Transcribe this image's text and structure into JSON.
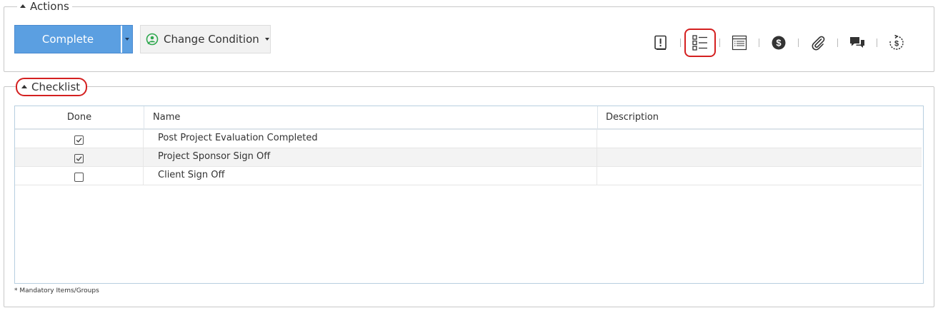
{
  "actions": {
    "legend": "Actions",
    "complete_label": "Complete",
    "change_condition_label": "Change Condition",
    "toolbar_icons": [
      "issues-icon",
      "checklist-icon",
      "details-icon",
      "cost-icon",
      "attachment-icon",
      "comments-icon",
      "budget-icon"
    ],
    "highlighted_icon": "checklist-icon"
  },
  "checklist": {
    "legend": "Checklist",
    "columns": [
      "Done",
      "Name",
      "Description"
    ],
    "rows": [
      {
        "done": true,
        "name": "Post Project Evaluation Completed",
        "description": ""
      },
      {
        "done": true,
        "name": "Project Sponsor Sign Off",
        "description": ""
      },
      {
        "done": false,
        "name": "Client Sign Off",
        "description": ""
      }
    ],
    "footnote": "* Mandatory Items/Groups"
  },
  "colors": {
    "primary_button": "#5b9fe1",
    "highlight": "#d42020",
    "condition_icon": "#2fa84f"
  }
}
